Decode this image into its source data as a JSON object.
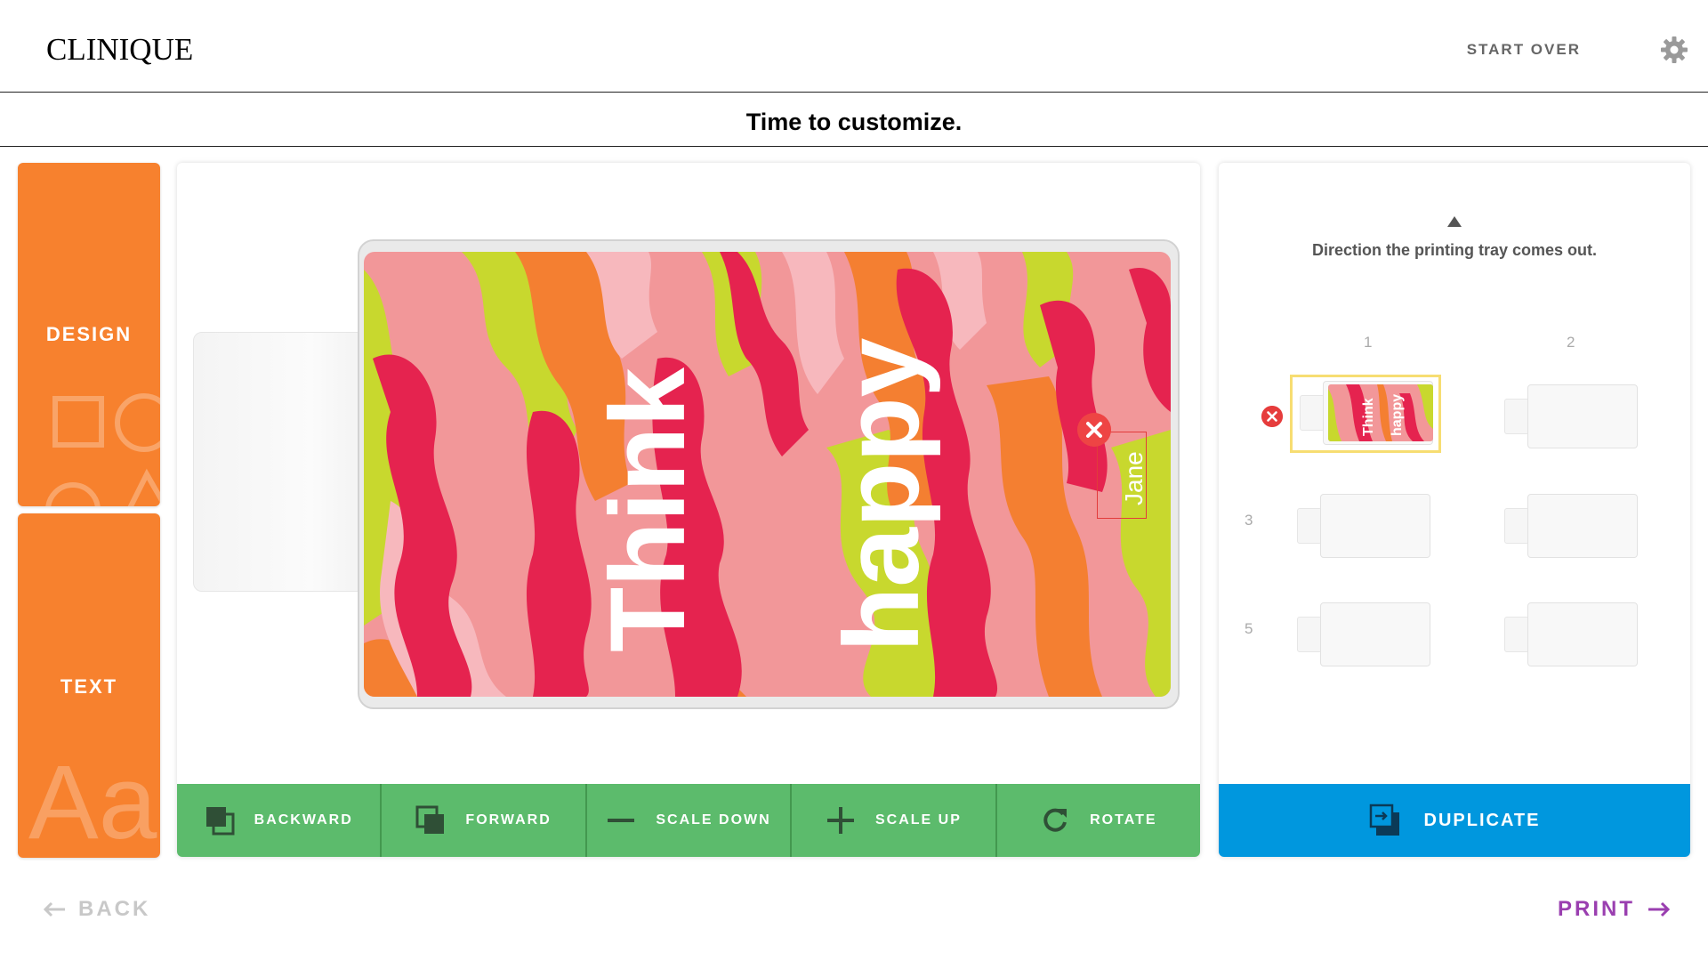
{
  "brand": {
    "logo": "CLINIQUE"
  },
  "header": {
    "start_over": "START OVER",
    "settings_icon": "gear-icon"
  },
  "subheader": {
    "title": "Time to customize."
  },
  "sidebar": {
    "tabs": [
      {
        "label": "DESIGN",
        "icon": "shapes-icon"
      },
      {
        "label": "TEXT",
        "icon": "aa-text-icon",
        "decor_text": "Aa"
      }
    ]
  },
  "canvas": {
    "design_text": [
      "Think",
      "happy"
    ],
    "name_text": "Jane",
    "pattern": "camo",
    "colors": {
      "base": "#f29799",
      "red": "#e5234f",
      "orange": "#f47f31",
      "lime": "#c8d82e",
      "pink": "#f7b8bd"
    }
  },
  "toolbar": {
    "backward": "BACKWARD",
    "forward": "FORWARD",
    "scale_down": "SCALE DOWN",
    "scale_up": "SCALE UP",
    "rotate": "ROTATE"
  },
  "tray": {
    "caption": "Direction the printing tray comes out.",
    "slot_numbers": [
      "1",
      "2",
      "3",
      "5"
    ],
    "duplicate": "DUPLICATE"
  },
  "footer": {
    "back": "BACK",
    "print": "PRINT"
  },
  "accent_colors": {
    "orange": "#f7812e",
    "green": "#5cbb6c",
    "blue": "#0097de",
    "purple": "#9a3fb0",
    "highlight": "#f7dd72"
  }
}
